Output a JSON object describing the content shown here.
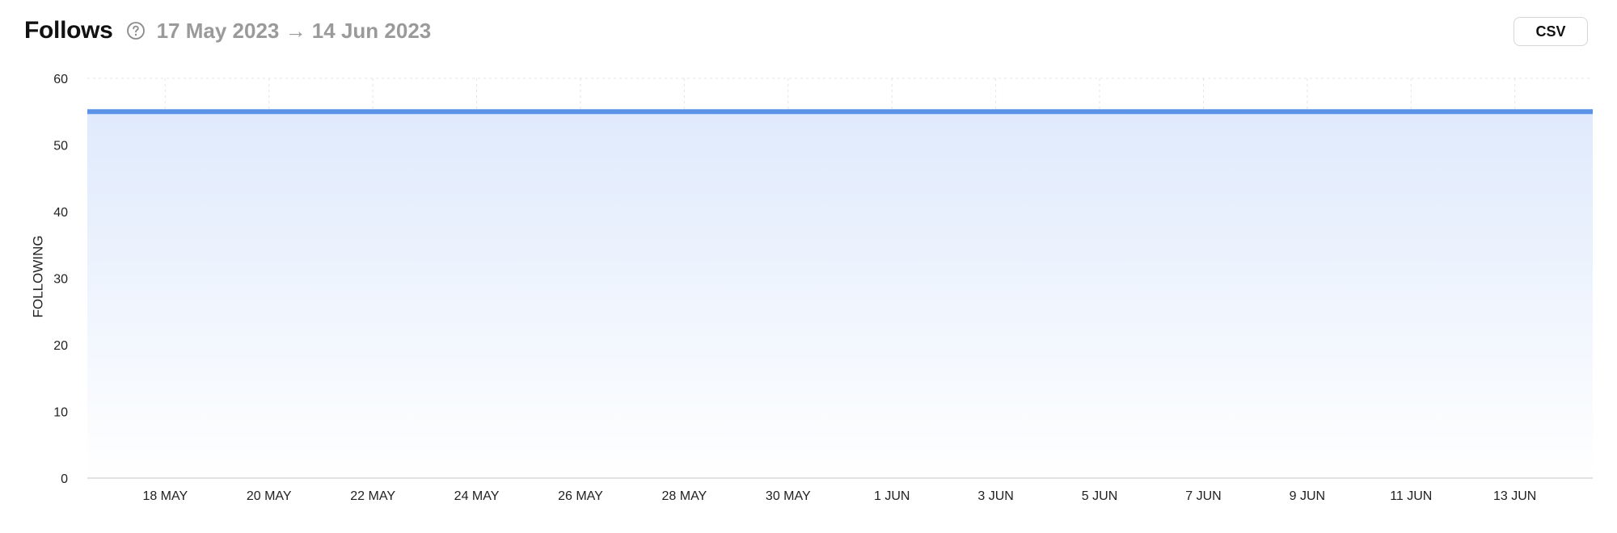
{
  "header": {
    "title": "Follows",
    "date_range": "17 May 2023 → 14 Jun 2023",
    "help_icon": "question-circle-icon"
  },
  "toolbar": {
    "csv_label": "CSV"
  },
  "colors": {
    "line": "#5b93e6",
    "fill_top": "#dfeafc",
    "grid": "#e4e4e4"
  },
  "chart_data": {
    "type": "area",
    "title": "",
    "xlabel": "",
    "ylabel": "FOLLOWING",
    "ylim": [
      0,
      60
    ],
    "yticks": [
      0,
      10,
      20,
      30,
      40,
      50,
      60
    ],
    "grid": true,
    "x_tick_labels": [
      "18 MAY",
      "20 MAY",
      "22 MAY",
      "24 MAY",
      "26 MAY",
      "28 MAY",
      "30 MAY",
      "1 JUN",
      "3 JUN",
      "5 JUN",
      "7 JUN",
      "9 JUN",
      "11 JUN",
      "13 JUN"
    ],
    "series": [
      {
        "x": [
          "17 MAY",
          "18 MAY",
          "19 MAY",
          "20 MAY",
          "21 MAY",
          "22 MAY",
          "23 MAY",
          "24 MAY",
          "25 MAY",
          "26 MAY",
          "27 MAY",
          "28 MAY",
          "29 MAY",
          "30 MAY",
          "31 MAY",
          "1 JUN",
          "2 JUN",
          "3 JUN",
          "4 JUN",
          "5 JUN",
          "6 JUN",
          "7 JUN",
          "8 JUN",
          "9 JUN",
          "10 JUN",
          "11 JUN",
          "12 JUN",
          "13 JUN",
          "14 JUN"
        ],
        "values": [
          55,
          55,
          55,
          55,
          55,
          55,
          55,
          55,
          55,
          55,
          55,
          55,
          55,
          55,
          55,
          55,
          55,
          55,
          55,
          55,
          55,
          55,
          55,
          55,
          55,
          55,
          55,
          55,
          55
        ]
      }
    ]
  }
}
